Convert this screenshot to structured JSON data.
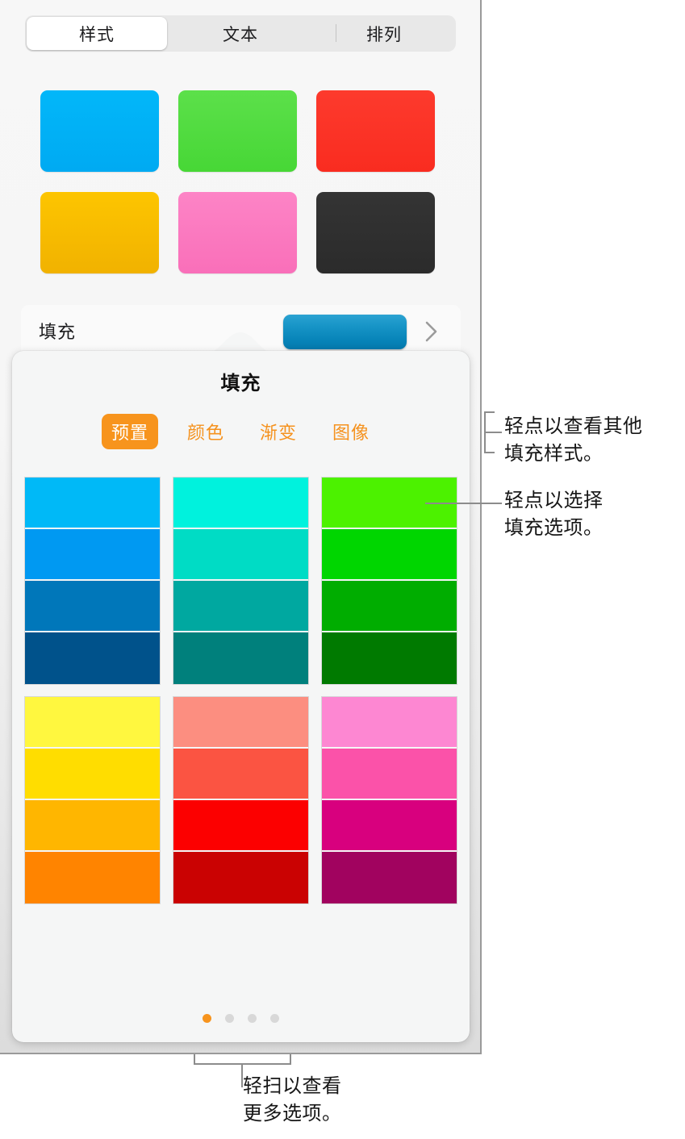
{
  "segmented_control": {
    "tabs": [
      {
        "label": "样式",
        "active": true
      },
      {
        "label": "文本",
        "active": false
      },
      {
        "label": "排列",
        "active": false
      }
    ]
  },
  "style_grid": {
    "swatches": [
      {
        "name": "style-swatch-blue",
        "top": "#02b7f9",
        "bottom": "#00aaf2"
      },
      {
        "name": "style-swatch-green",
        "top": "#5ce04a",
        "bottom": "#47d736"
      },
      {
        "name": "style-swatch-red",
        "top": "#fd3a2d",
        "bottom": "#f92c20"
      },
      {
        "name": "style-swatch-yellow",
        "top": "#fdc500",
        "bottom": "#f1b200"
      },
      {
        "name": "style-swatch-pink",
        "top": "#fd84c6",
        "bottom": "#f96fb9"
      },
      {
        "name": "style-swatch-black",
        "top": "#343434",
        "bottom": "#2b2b2b"
      }
    ]
  },
  "fill_row": {
    "label": "填充",
    "swatch_color": "#0f8cbd",
    "disclosure_icon": "chevron-right-icon"
  },
  "popover": {
    "title": "填充",
    "tabs": [
      {
        "label": "预置",
        "active": true
      },
      {
        "label": "颜色",
        "active": false
      },
      {
        "label": "渐变",
        "active": false
      },
      {
        "label": "图像",
        "active": false
      }
    ],
    "accent_color": "#f7941d",
    "preset_groups": [
      {
        "name": "preset-group-blue",
        "colors": [
          "#00b9f7",
          "#0099f2",
          "#0077ba",
          "#00528b"
        ]
      },
      {
        "name": "preset-group-cyan",
        "colors": [
          "#00f2dd",
          "#00dcc5",
          "#00a8a0",
          "#00807c"
        ]
      },
      {
        "name": "preset-group-green",
        "colors": [
          "#4cf200",
          "#00d600",
          "#00ad00",
          "#007a00"
        ]
      },
      {
        "name": "preset-group-yellow",
        "colors": [
          "#fff73f",
          "#ffdd00",
          "#ffb600",
          "#ff8400"
        ]
      },
      {
        "name": "preset-group-salmon",
        "colors": [
          "#fc8e80",
          "#fb5442",
          "#fc0000",
          "#ca0202"
        ]
      },
      {
        "name": "preset-group-magenta",
        "colors": [
          "#fd87d2",
          "#fb52a9",
          "#d8007e",
          "#a1035f"
        ]
      }
    ],
    "page_dots": {
      "count": 4,
      "active_index": 0
    }
  },
  "callouts": [
    {
      "name": "callout-view-other-fill-styles",
      "text": "轻点以查看其他\n填充样式。"
    },
    {
      "name": "callout-choose-fill-option",
      "text": "轻点以选择\n填充选项。"
    },
    {
      "name": "callout-swipe-more-options",
      "text": "轻扫以查看\n更多选项。"
    }
  ]
}
